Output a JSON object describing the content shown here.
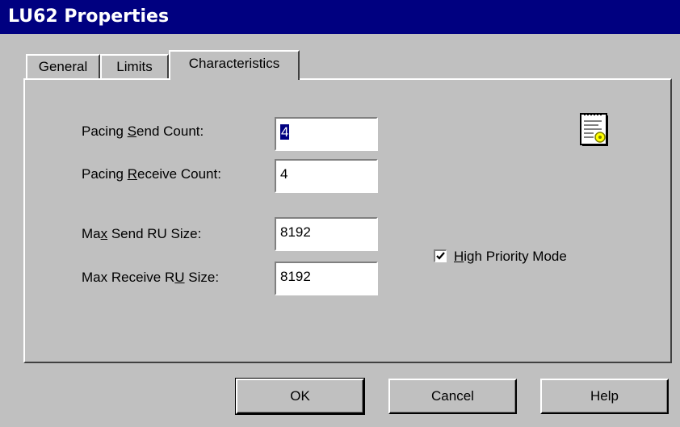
{
  "window": {
    "title": "LU62 Properties"
  },
  "tabs": [
    {
      "label": "General",
      "active": false
    },
    {
      "label": "Limits",
      "active": false
    },
    {
      "label": "Characteristics",
      "active": true
    }
  ],
  "fields": {
    "pacing_send": {
      "label_pre": "Pacing ",
      "label_mn": "S",
      "label_post": "end Count:",
      "value": "4"
    },
    "pacing_receive": {
      "label_pre": "Pacing ",
      "label_mn": "R",
      "label_post": "eceive Count:",
      "value": "4"
    },
    "max_send_ru": {
      "label_pre": "Ma",
      "label_mn": "x",
      "label_post": " Send RU Size:",
      "value": "8192"
    },
    "max_receive_ru": {
      "label_pre": "Max Receive R",
      "label_mn": "U",
      "label_post": " Size:",
      "value": "8192"
    }
  },
  "high_priority": {
    "label_pre": "",
    "label_mn": "H",
    "label_post": "igh Priority Mode",
    "checked": true
  },
  "buttons": {
    "ok": "OK",
    "cancel": "Cancel",
    "help": "Help"
  },
  "icons": {
    "properties": "properties-document-icon"
  }
}
